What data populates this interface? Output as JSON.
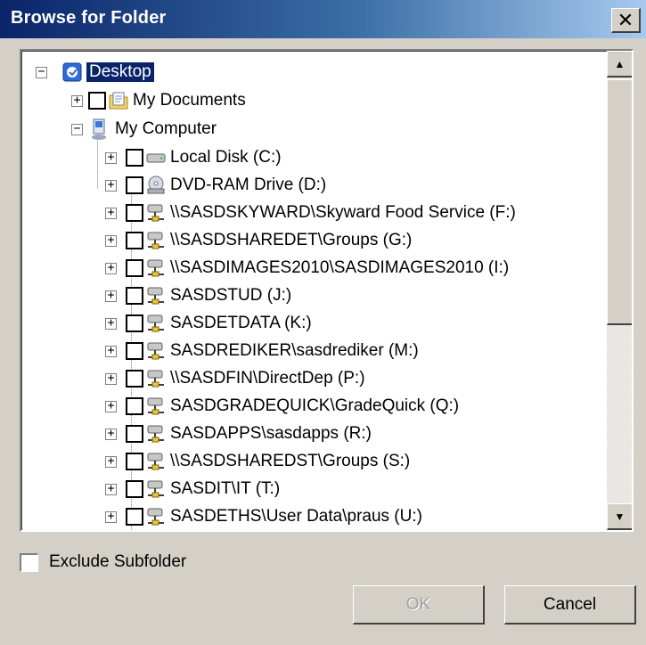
{
  "window": {
    "title": "Browse for Folder",
    "close_glyph": "✕"
  },
  "tree": {
    "desktop": {
      "label": "Desktop",
      "expander": "−",
      "icon": "desktop-icon"
    },
    "my_documents": {
      "label": "My Documents",
      "expander": "+",
      "icon": "folder-documents-icon"
    },
    "my_computer": {
      "label": "My Computer",
      "expander": "−",
      "icon": "computer-icon"
    },
    "drives": [
      {
        "label": "Local Disk (C:)",
        "icon": "hard-disk-icon"
      },
      {
        "label": "DVD-RAM Drive (D:)",
        "icon": "dvd-drive-icon"
      },
      {
        "label": "\\\\SASDSKYWARD\\Skyward Food Service (F:)",
        "icon": "network-drive-icon"
      },
      {
        "label": "\\\\SASDSHAREDET\\Groups (G:)",
        "icon": "network-drive-icon"
      },
      {
        "label": "\\\\SASDIMAGES2010\\SASDIMAGES2010 (I:)",
        "icon": "network-drive-icon"
      },
      {
        "label": "SASDSTUD (J:)",
        "icon": "network-drive-icon"
      },
      {
        "label": "SASDETDATA (K:)",
        "icon": "network-drive-icon"
      },
      {
        "label": "SASDREDIKER\\sasdrediker (M:)",
        "icon": "network-drive-icon"
      },
      {
        "label": "\\\\SASDFIN\\DirectDep (P:)",
        "icon": "network-drive-icon"
      },
      {
        "label": "SASDGRADEQUICK\\GradeQuick (Q:)",
        "icon": "network-drive-icon"
      },
      {
        "label": "SASDAPPS\\sasdapps (R:)",
        "icon": "network-drive-icon"
      },
      {
        "label": "\\\\SASDSHAREDST\\Groups (S:)",
        "icon": "network-drive-icon"
      },
      {
        "label": "SASDIT\\IT (T:)",
        "icon": "network-drive-icon"
      },
      {
        "label": "SASDETHS\\User Data\\praus (U:)",
        "icon": "network-drive-icon"
      }
    ],
    "drive_expander": "+"
  },
  "scrollbar": {
    "up_glyph": "▲",
    "down_glyph": "▼"
  },
  "options": {
    "exclude_subfolder_label": "Exclude Subfolder",
    "exclude_subfolder_checked": false
  },
  "buttons": {
    "ok_label": "OK",
    "ok_enabled": false,
    "cancel_label": "Cancel"
  },
  "colors": {
    "title_start": "#0a246a",
    "title_end": "#a6caf0",
    "selection": "#0a246a",
    "face": "#d4d0c8"
  }
}
